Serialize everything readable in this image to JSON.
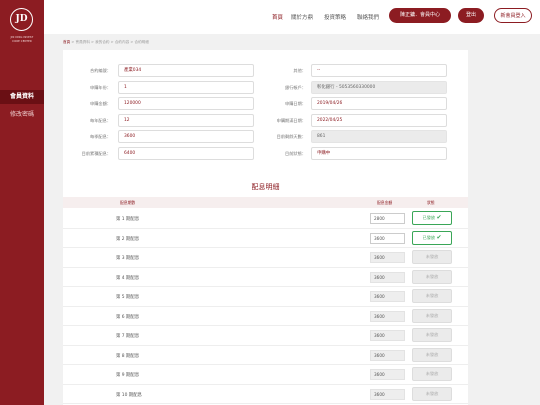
{
  "brand": {
    "mark": "JD",
    "line1": "JIN DING INVEST",
    "line2": "CORE CENTER"
  },
  "sidebar": {
    "items": [
      {
        "label": "會員資料",
        "active": true
      },
      {
        "label": "修改密碼",
        "active": false
      }
    ]
  },
  "nav": {
    "items": [
      "首頁",
      "關於方鼎",
      "投資策略",
      "聯絡我們"
    ],
    "member_center": "陳正鏞．會員中心",
    "logout": "登出",
    "new_member": "新會員登入"
  },
  "breadcrumb": [
    "首頁",
    "會員資料",
    "我的合約",
    "合約內容",
    "合約明細"
  ],
  "contract": {
    "left": [
      {
        "label": "合約編號：",
        "value": "產業034",
        "grey": false
      },
      {
        "label": "申購年份：",
        "value": "1",
        "grey": false
      },
      {
        "label": "申購金額：",
        "value": "120000",
        "grey": false
      },
      {
        "label": "每年配息：",
        "value": "12",
        "grey": false
      },
      {
        "label": "每季配息：",
        "value": "3600",
        "grey": false
      },
      {
        "label": "目前累積配息：",
        "value": "6400",
        "grey": false
      }
    ],
    "right": [
      {
        "label": "其他：",
        "value": "--",
        "grey": false
      },
      {
        "label": "銀行帳戶：",
        "value": "彰化銀行 - 5053560330000",
        "grey": true
      },
      {
        "label": "申購日期：",
        "value": "2019/04/26",
        "grey": false
      },
      {
        "label": "申購期滿日期：",
        "value": "2022/04/25",
        "grey": false
      },
      {
        "label": "目前剩餘天數：",
        "value": "861",
        "grey": true
      },
      {
        "label": "目前狀態：",
        "value": "申購中",
        "grey": false
      }
    ]
  },
  "distribution": {
    "title": "配息明細",
    "headers": {
      "period": "配息期數",
      "amount": "配息金額",
      "status": "狀態"
    },
    "rows": [
      {
        "period": "第 1 期配息",
        "amount": "2800",
        "status": "已發放",
        "paid": true
      },
      {
        "period": "第 2 期配息",
        "amount": "3600",
        "status": "已發放",
        "paid": true
      },
      {
        "period": "第 3 期配息",
        "amount": "3600",
        "status": "未發放",
        "paid": false
      },
      {
        "period": "第 4 期配息",
        "amount": "3600",
        "status": "未發放",
        "paid": false
      },
      {
        "period": "第 5 期配息",
        "amount": "3600",
        "status": "未發放",
        "paid": false
      },
      {
        "period": "第 6 期配息",
        "amount": "3600",
        "status": "未發放",
        "paid": false
      },
      {
        "period": "第 7 期配息",
        "amount": "3600",
        "status": "未發放",
        "paid": false
      },
      {
        "period": "第 8 期配息",
        "amount": "3600",
        "status": "未發放",
        "paid": false
      },
      {
        "period": "第 9 期配息",
        "amount": "3600",
        "status": "未發放",
        "paid": false
      },
      {
        "period": "第 10 期配息",
        "amount": "3600",
        "status": "未發放",
        "paid": false
      }
    ]
  },
  "colors": {
    "brand": "#8c1c22",
    "paid": "#3aa657"
  }
}
